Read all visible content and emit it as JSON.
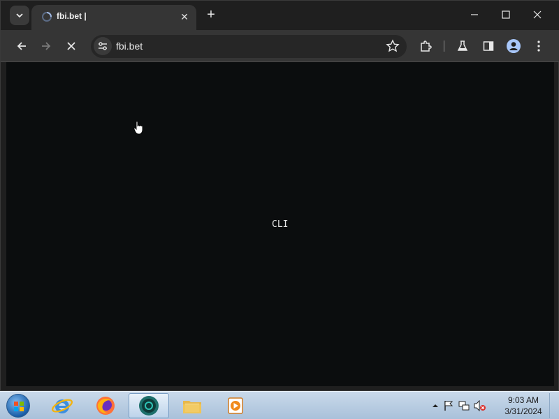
{
  "browser": {
    "tab": {
      "title": "fbi.bet |",
      "favicon": "loading-spinner-icon"
    },
    "address": {
      "url": "fbi.bet"
    },
    "colors": {
      "frame": "#1f1f1f",
      "toolbar": "#353535",
      "page_bg": "#0b0d0e"
    }
  },
  "page": {
    "center_text": "CLI"
  },
  "taskbar": {
    "apps": [
      {
        "name": "internet-explorer",
        "icon": "ie-icon"
      },
      {
        "name": "firefox",
        "icon": "firefox-icon"
      },
      {
        "name": "chrome-beta",
        "icon": "chrome-icon",
        "active": true
      },
      {
        "name": "file-explorer",
        "icon": "folder-icon"
      },
      {
        "name": "media-player",
        "icon": "media-player-icon"
      }
    ],
    "clock": {
      "time": "9:03 AM",
      "date": "3/31/2024"
    }
  }
}
